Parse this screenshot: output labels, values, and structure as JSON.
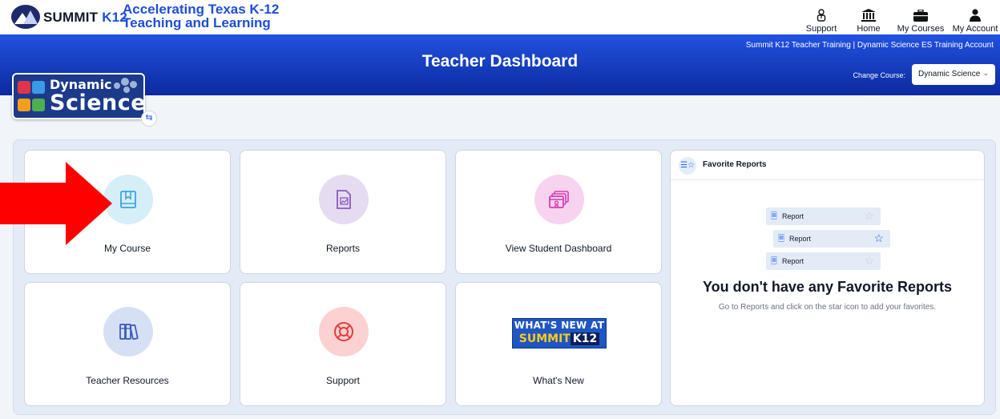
{
  "brand": {
    "name": "SUMMIT",
    "name_suffix": "K12",
    "tagline_line1": "Accelerating Texas K-12",
    "tagline_line2": "Teaching and Learning"
  },
  "topnav": [
    {
      "label": "Support",
      "icon": "support-person-icon"
    },
    {
      "label": "Home",
      "icon": "home-building-icon"
    },
    {
      "label": "My Courses",
      "icon": "briefcase-icon"
    },
    {
      "label": "My Account",
      "icon": "user-icon"
    }
  ],
  "banner": {
    "title": "Teacher Dashboard",
    "account_line": "Summit K12 Teacher Training | Dynamic Science ES Training Account",
    "change_course_label": "Change Course:",
    "course_selected": "Dynamic Science"
  },
  "course_logo": {
    "line1": "Dynamic",
    "line2": "Science"
  },
  "cards": [
    {
      "label": "My Course",
      "icon": "book-icon",
      "circle_color": "#d6eef8",
      "icon_color": "#3aa6d8"
    },
    {
      "label": "Reports",
      "icon": "report-chart-icon",
      "circle_color": "#e6dcf1",
      "icon_color": "#8a5cb8"
    },
    {
      "label": "View Student Dashboard",
      "icon": "certificate-windows-icon",
      "circle_color": "#f8d3ef",
      "icon_color": "#d63cb3"
    },
    {
      "label": "Teacher Resources",
      "icon": "books-icon",
      "circle_color": "#d6e0f5",
      "icon_color": "#3657b8"
    },
    {
      "label": "Support",
      "icon": "lifebuoy-icon",
      "circle_color": "#fcd1d1",
      "icon_color": "#e53b3b"
    },
    {
      "label": "What's New",
      "icon": "whats-new-badge",
      "badge_line1": "WHAT'S NEW AT",
      "badge_line2a": "SUMMIT",
      "badge_line2b": "K12"
    }
  ],
  "favorites": {
    "header": "Favorite Reports",
    "chips": [
      {
        "label": "Report",
        "starred": false
      },
      {
        "label": "Report",
        "starred": true
      },
      {
        "label": "Report",
        "starred": false
      }
    ],
    "empty_title": "You don't have any Favorite Reports",
    "empty_subtitle": "Go to Reports and click on the star icon to add your favorites."
  },
  "colors": {
    "brand_blue": "#1d4ed8",
    "banner_top": "#2152e0",
    "banner_bottom": "#0b2a9e",
    "arrow_red": "#ff0000"
  }
}
